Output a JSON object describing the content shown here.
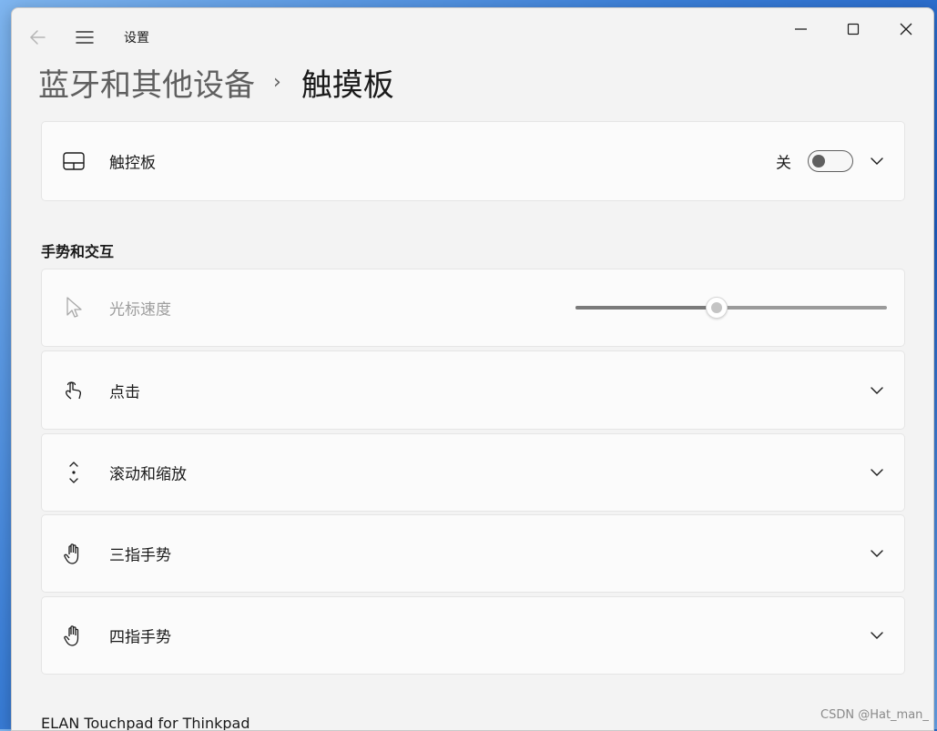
{
  "app": {
    "title": "设置"
  },
  "breadcrumb": {
    "parent": "蓝牙和其他设备",
    "separator": "›",
    "current": "触摸板"
  },
  "touchpad": {
    "label": "触控板",
    "toggle_state_text": "关",
    "toggle_on": false,
    "icon": "touchpad-icon"
  },
  "gestures_section": {
    "title": "手势和交互"
  },
  "pointer_speed": {
    "label": "光标速度",
    "value": 0.45,
    "enabled": false,
    "icon": "cursor-icon"
  },
  "items": [
    {
      "label": "点击",
      "icon": "tap-icon"
    },
    {
      "label": "滚动和缩放",
      "icon": "scroll-icon"
    },
    {
      "label": "三指手势",
      "icon": "hand-icon"
    },
    {
      "label": "四指手势",
      "icon": "hand-icon"
    }
  ],
  "device_section": {
    "title": "ELAN Touchpad for Thinkpad"
  },
  "watermark": "CSDN @Hat_man_",
  "colors": {
    "text": "#1a1a1a",
    "muted": "#9e9e9e",
    "card_bg": "#fbfbfb",
    "window_bg": "#f3f3f3"
  }
}
